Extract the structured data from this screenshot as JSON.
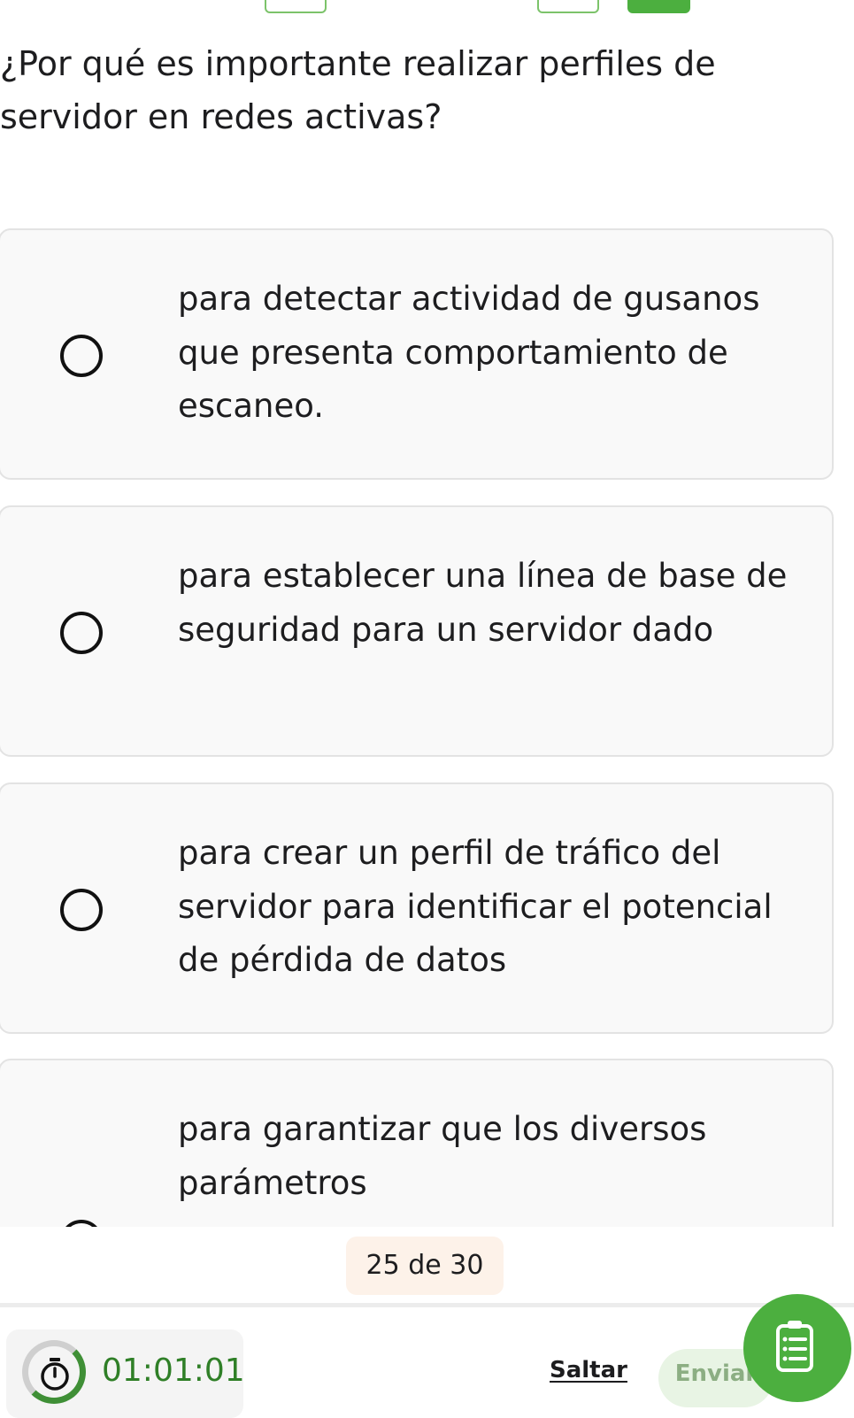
{
  "question": {
    "text": "¿Por qué es importante realizar perfiles de servidor en redes activas?"
  },
  "options": [
    {
      "text": "para detectar actividad de gusanos que presenta comportamiento de escaneo."
    },
    {
      "text": "para establecer una línea de base de seguridad para un servidor dado"
    },
    {
      "text": "para crear un perfil de tráfico del servidor para identificar el potencial de pérdida de datos"
    },
    {
      "text": "para garantizar que los diversos parámetros"
    }
  ],
  "progress": {
    "label": "25 de 30"
  },
  "timer": {
    "value": "01:01:01",
    "icon": "stopwatch-icon"
  },
  "footer": {
    "skip_label": "Saltar",
    "submit_label": "Enviar",
    "list_icon": "checklist-icon"
  },
  "colors": {
    "accent_green": "#4caf3f",
    "timer_green": "#2f7f27",
    "progress_bg": "#fdf2e9"
  }
}
